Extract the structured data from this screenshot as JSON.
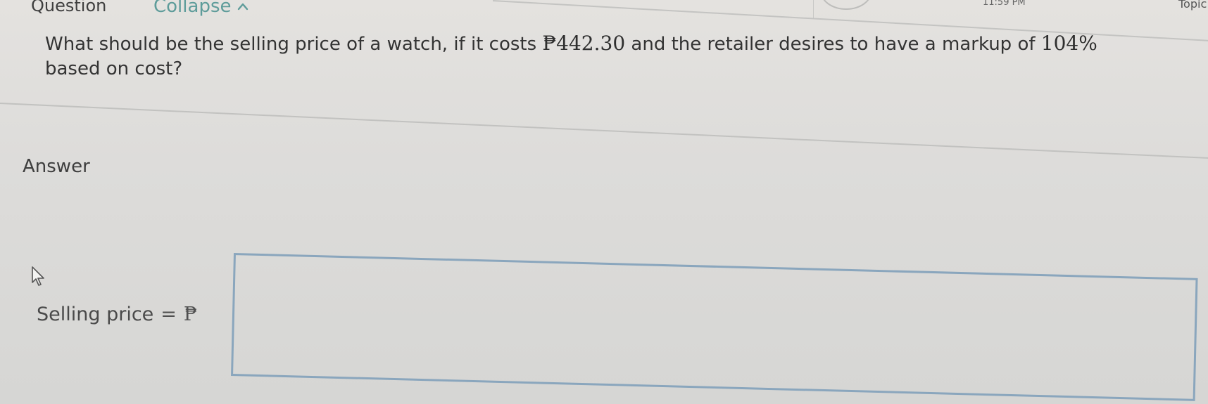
{
  "header": {
    "question_label": "Question",
    "collapse_label": "Collapse",
    "collapse_symbol": "^",
    "clock": "11:59 PM",
    "topic_label": "Topic"
  },
  "question": {
    "line1_prefix": "What should be the selling price of a watch, if it costs ",
    "cost": "₱442.30",
    "line1_middle": " and the retailer desires to have a markup of ",
    "markup": "104%",
    "line2": "based on cost?"
  },
  "answer": {
    "heading": "Answer",
    "field_label": "Selling price",
    "equals": "=",
    "currency": "₱",
    "input_value": "",
    "input_placeholder": ""
  },
  "colors": {
    "accent": "#5e9c9a",
    "input_border": "#8aa6bd",
    "background": "#dddcda"
  }
}
